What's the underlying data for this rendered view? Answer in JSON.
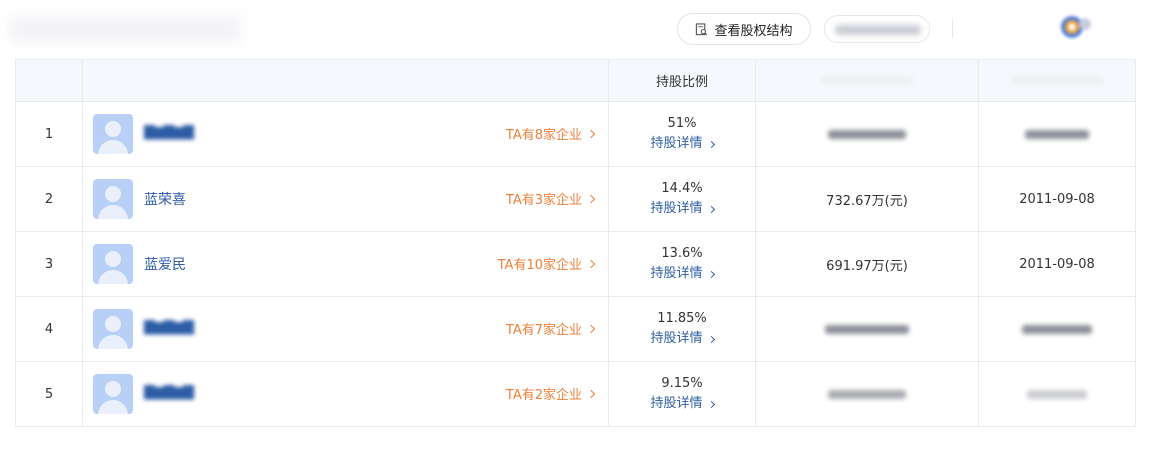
{
  "toolbar": {
    "equity_structure_label": "查看股权结构",
    "equity_icon": "search-document-icon"
  },
  "table": {
    "header_ratio": "持股比例",
    "rows": [
      {
        "no": "1",
        "name": "",
        "name_blurred": true,
        "companies": "TA有8家企业",
        "ratio": "51%",
        "detail": "持股详情",
        "amount": "",
        "date": ""
      },
      {
        "no": "2",
        "name": "蓝荣喜",
        "name_blurred": false,
        "companies": "TA有3家企业",
        "ratio": "14.4%",
        "detail": "持股详情",
        "amount": "732.67万(元)",
        "date": "2011-09-08"
      },
      {
        "no": "3",
        "name": "蓝爱民",
        "name_blurred": false,
        "companies": "TA有10家企业",
        "ratio": "13.6%",
        "detail": "持股详情",
        "amount": "691.97万(元)",
        "date": "2011-09-08"
      },
      {
        "no": "4",
        "name": "",
        "name_blurred": true,
        "companies": "TA有7家企业",
        "ratio": "11.85%",
        "detail": "持股详情",
        "amount": "",
        "date": ""
      },
      {
        "no": "5",
        "name": "",
        "name_blurred": true,
        "companies": "TA有2家企业",
        "ratio": "9.15%",
        "detail": "持股详情",
        "amount": "",
        "date": ""
      }
    ]
  },
  "colors": {
    "link_blue": "#2d5da6",
    "accent_orange": "#f07f3a",
    "header_bg": "#f5f8fc",
    "border": "#e6ebf2"
  }
}
